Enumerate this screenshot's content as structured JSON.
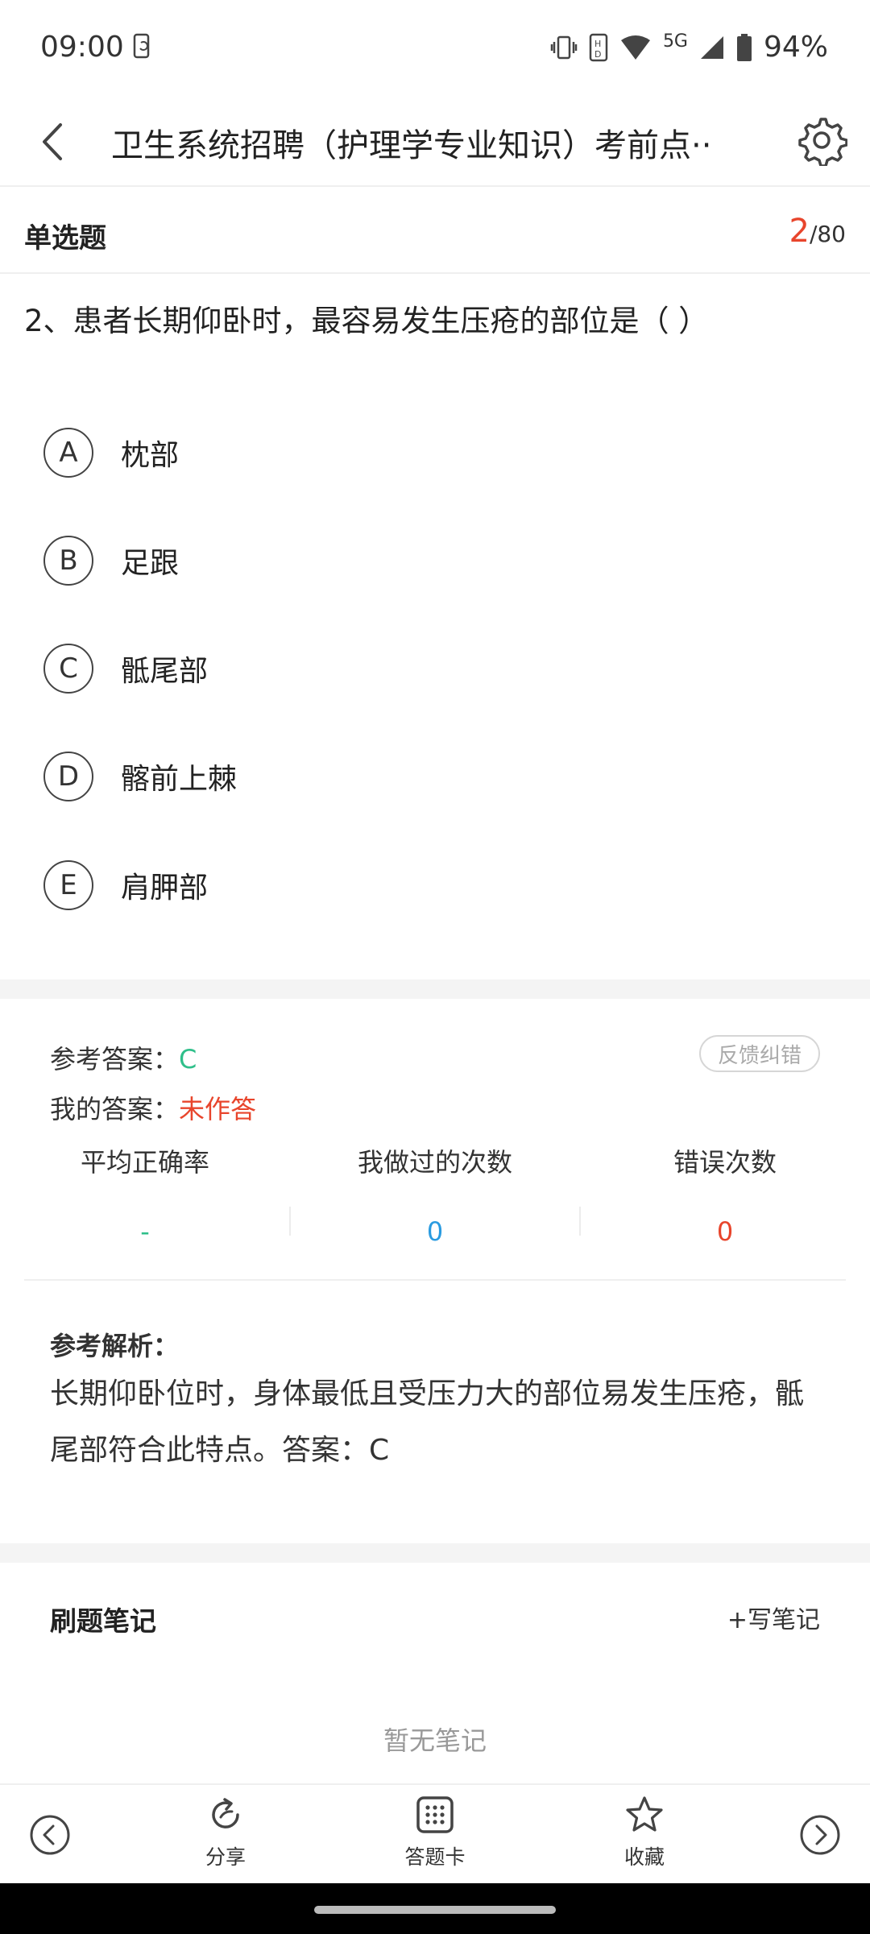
{
  "status_bar": {
    "time": "09:00",
    "network": "5G",
    "battery": "94%",
    "icons": [
      "phone-sync-icon",
      "vibrate-icon",
      "data-icon",
      "wifi-icon",
      "signal-icon",
      "battery-icon"
    ]
  },
  "header": {
    "title": "卫生系统招聘（护理学专业知识）考前点··",
    "icons": [
      "back-icon",
      "gear-icon"
    ]
  },
  "question": {
    "type_label": "单选题",
    "current_index": "2",
    "total": "/80",
    "text": "2、患者长期仰卧时，最容易发生压疮的部位是（     ）",
    "options": [
      {
        "letter": "A",
        "text": "枕部"
      },
      {
        "letter": "B",
        "text": "足跟"
      },
      {
        "letter": "C",
        "text": "骶尾部"
      },
      {
        "letter": "D",
        "text": "髂前上棘"
      },
      {
        "letter": "E",
        "text": "肩胛部"
      }
    ]
  },
  "answer": {
    "reference_label": "参考答案：",
    "reference_value": "C",
    "mine_label": "我的答案：",
    "mine_value": "未作答",
    "feedback_label": "反馈纠错",
    "accent_green": "#2fbf8a",
    "accent_red": "#e8452c"
  },
  "stats": [
    {
      "label": "平均正确率",
      "value": "-",
      "color": "#2fbf8a"
    },
    {
      "label": "我做过的次数",
      "value": "0",
      "color": "#2a9be0"
    },
    {
      "label": "错误次数",
      "value": "0",
      "color": "#e8452c"
    }
  ],
  "analysis": {
    "title": "参考解析：",
    "text": "长期仰卧位时，身体最低且受压力大的部位易发生压疮，骶尾部符合此特点。答案：C"
  },
  "notes": {
    "title": "刷题笔记",
    "write_label": "+写笔记",
    "empty_label": "暂无笔记"
  },
  "toolbar": {
    "share_label": "分享",
    "card_label": "答题卡",
    "favorite_label": "收藏",
    "icons": [
      "prev-icon",
      "share-icon",
      "answer-card-icon",
      "star-icon",
      "next-icon"
    ]
  }
}
